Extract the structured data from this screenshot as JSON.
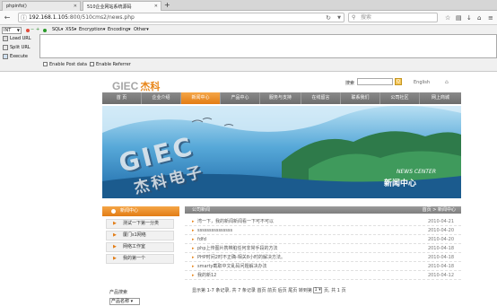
{
  "browser": {
    "tabs": [
      {
        "label": "phpinfo()"
      },
      {
        "label": "510企业网站系统源码"
      }
    ],
    "new_tab": "+",
    "url_host": "192.168.1.105",
    "url_path": ":800/510cms2/news.php",
    "search_placeholder": "搜索"
  },
  "hackbar": {
    "select_value": "INT",
    "menus": [
      "SQL▾",
      "XSS▾",
      "Encryption▾",
      "Encoding▾",
      "Other▾"
    ],
    "actions": [
      "Load URL",
      "Split URL",
      "Execute"
    ],
    "checks": [
      "Enable Post data",
      "Enable Referrer"
    ]
  },
  "site": {
    "logo_text": "GIEC",
    "logo_cn": "杰科",
    "search_label": "搜索",
    "search_button": "Q",
    "lang": "English",
    "nav": [
      "首  页",
      "企业介绍",
      "新闻中心",
      "产品中心",
      "服务与支持",
      "在线留言",
      "联系我们",
      "公司社区",
      "网上商城"
    ],
    "nav_active_index": 2,
    "banner": {
      "logo_latin": "GIEC",
      "logo_cn": "杰科电子",
      "en": "NEWS CENTER",
      "cn": "新闻中心"
    },
    "sidebar": {
      "header": "新闻中心",
      "items": [
        "测试一下第一分类",
        "厦门s1网络",
        "网络工作室",
        "我的第一个"
      ],
      "product_label": "产品搜索",
      "product_select": "产品名称 ▾"
    },
    "content": {
      "header": "公司新闻",
      "breadcrumb": "首页 > 新闻中心",
      "news": [
        {
          "title": "湾一下，我的新闻新闻看一下可不可以",
          "date": "2010-04-21"
        },
        {
          "title": "sssssssssssssss",
          "date": "2010-04-20"
        },
        {
          "title": "fdfd",
          "date": "2010-04-20"
        },
        {
          "title": "php上传图片携带脏任何非常手段的方法",
          "date": "2010-04-18"
        },
        {
          "title": "PHP时间2时不正确-相关8小时的解决方法。",
          "date": "2010-04-18"
        },
        {
          "title": "smarty截取中文乱码问题解决办法",
          "date": "2010-04-18"
        },
        {
          "title": "我的新12",
          "date": "2010-04-12"
        }
      ],
      "pager_text": "显示第 1-7 条记录, 共 7 条记录 首页 前页 后页 尾页 转到第",
      "pager_select": "1 ▾",
      "pager_tail": "页, 共 1 页"
    }
  }
}
